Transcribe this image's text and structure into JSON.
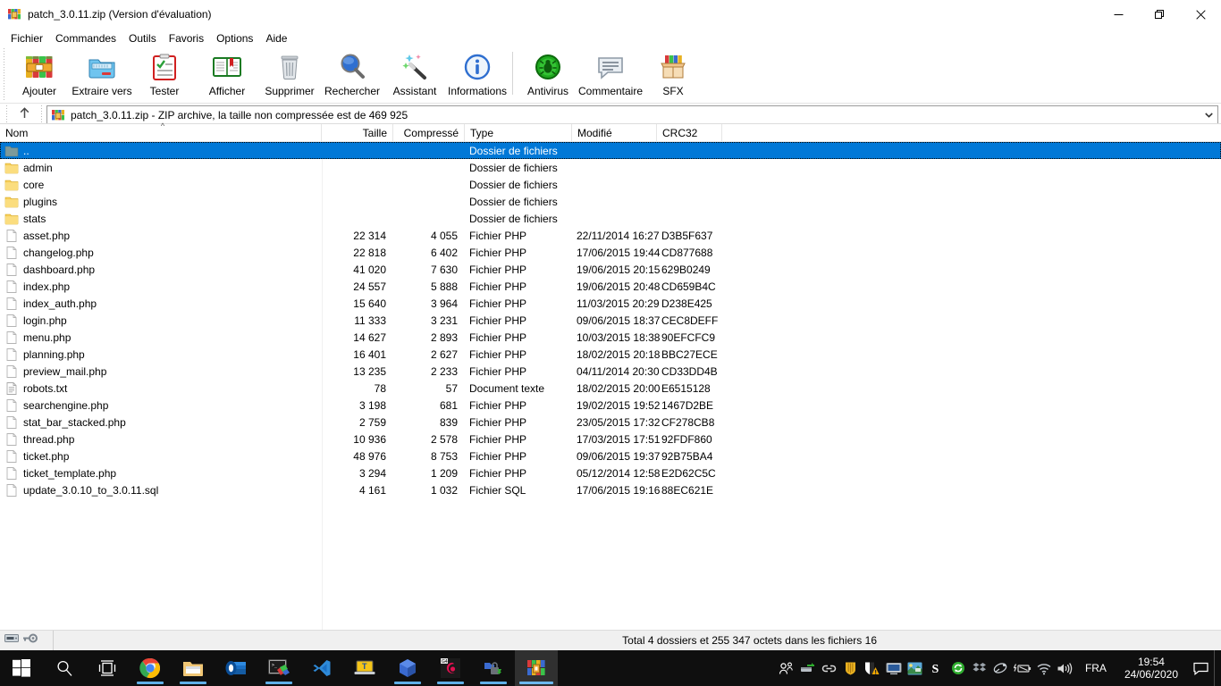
{
  "window": {
    "title": "patch_3.0.11.zip (Version d'évaluation)",
    "app_icon": "winrar-books-icon",
    "controls": {
      "minimize": "—",
      "restore": "❐",
      "close": "✕"
    }
  },
  "menubar": {
    "items": [
      {
        "label": "Fichier"
      },
      {
        "label": "Commandes"
      },
      {
        "label": "Outils"
      },
      {
        "label": "Favoris"
      },
      {
        "label": "Options"
      },
      {
        "label": "Aide"
      }
    ]
  },
  "toolbar": {
    "buttons": [
      {
        "label": "Ajouter",
        "icon": "add-archive-icon"
      },
      {
        "label": "Extraire vers",
        "icon": "extract-folder-icon"
      },
      {
        "label": "Tester",
        "icon": "test-clipboard-icon"
      },
      {
        "label": "Afficher",
        "icon": "view-book-icon"
      },
      {
        "label": "Supprimer",
        "icon": "delete-trash-icon"
      },
      {
        "label": "Rechercher",
        "icon": "search-magnifier-icon"
      },
      {
        "label": "Assistant",
        "icon": "wizard-wand-icon"
      },
      {
        "label": "Informations",
        "icon": "info-circle-icon"
      },
      {
        "label": "Antivirus",
        "icon": "antivirus-bug-icon"
      },
      {
        "label": "Commentaire",
        "icon": "comment-bubble-icon"
      },
      {
        "label": "SFX",
        "icon": "sfx-box-icon"
      }
    ],
    "separator_after_index": 7
  },
  "addressbar": {
    "up_button": "up-arrow-icon",
    "archive_icon": "winrar-books-icon",
    "path_text": "patch_3.0.11.zip - ZIP archive, la taille non compressée est de 469 925",
    "dropdown": "chevron-down-icon"
  },
  "filelist": {
    "columns": [
      {
        "label": "Nom",
        "align": "left"
      },
      {
        "label": "Taille",
        "align": "right"
      },
      {
        "label": "Compressé",
        "align": "right"
      },
      {
        "label": "Type",
        "align": "left"
      },
      {
        "label": "Modifié",
        "align": "left"
      },
      {
        "label": "CRC32",
        "align": "left"
      }
    ],
    "sort_indicator": "^",
    "rows": [
      {
        "name": "..",
        "size": "",
        "compressed": "",
        "type": "Dossier de fichiers",
        "modified": "",
        "crc32": "",
        "icon": "parent-folder-icon",
        "selected": true
      },
      {
        "name": "admin",
        "size": "",
        "compressed": "",
        "type": "Dossier de fichiers",
        "modified": "",
        "crc32": "",
        "icon": "folder-icon",
        "selected": false
      },
      {
        "name": "core",
        "size": "",
        "compressed": "",
        "type": "Dossier de fichiers",
        "modified": "",
        "crc32": "",
        "icon": "folder-icon",
        "selected": false
      },
      {
        "name": "plugins",
        "size": "",
        "compressed": "",
        "type": "Dossier de fichiers",
        "modified": "",
        "crc32": "",
        "icon": "folder-icon",
        "selected": false
      },
      {
        "name": "stats",
        "size": "",
        "compressed": "",
        "type": "Dossier de fichiers",
        "modified": "",
        "crc32": "",
        "icon": "folder-icon",
        "selected": false
      },
      {
        "name": "asset.php",
        "size": "22 314",
        "compressed": "4 055",
        "type": "Fichier PHP",
        "modified": "22/11/2014 16:27",
        "crc32": "D3B5F637",
        "icon": "file-icon",
        "selected": false
      },
      {
        "name": "changelog.php",
        "size": "22 818",
        "compressed": "6 402",
        "type": "Fichier PHP",
        "modified": "17/06/2015 19:44",
        "crc32": "CD877688",
        "icon": "file-icon",
        "selected": false
      },
      {
        "name": "dashboard.php",
        "size": "41 020",
        "compressed": "7 630",
        "type": "Fichier PHP",
        "modified": "19/06/2015 20:15",
        "crc32": "629B0249",
        "icon": "file-icon",
        "selected": false
      },
      {
        "name": "index.php",
        "size": "24 557",
        "compressed": "5 888",
        "type": "Fichier PHP",
        "modified": "19/06/2015 20:48",
        "crc32": "CD659B4C",
        "icon": "file-icon",
        "selected": false
      },
      {
        "name": "index_auth.php",
        "size": "15 640",
        "compressed": "3 964",
        "type": "Fichier PHP",
        "modified": "11/03/2015 20:29",
        "crc32": "D238E425",
        "icon": "file-icon",
        "selected": false
      },
      {
        "name": "login.php",
        "size": "11 333",
        "compressed": "3 231",
        "type": "Fichier PHP",
        "modified": "09/06/2015 18:37",
        "crc32": "CEC8DEFF",
        "icon": "file-icon",
        "selected": false
      },
      {
        "name": "menu.php",
        "size": "14 627",
        "compressed": "2 893",
        "type": "Fichier PHP",
        "modified": "10/03/2015 18:38",
        "crc32": "90EFCFC9",
        "icon": "file-icon",
        "selected": false
      },
      {
        "name": "planning.php",
        "size": "16 401",
        "compressed": "2 627",
        "type": "Fichier PHP",
        "modified": "18/02/2015 20:18",
        "crc32": "BBC27ECE",
        "icon": "file-icon",
        "selected": false
      },
      {
        "name": "preview_mail.php",
        "size": "13 235",
        "compressed": "2 233",
        "type": "Fichier PHP",
        "modified": "04/11/2014 20:30",
        "crc32": "CD33DD4B",
        "icon": "file-icon",
        "selected": false
      },
      {
        "name": "robots.txt",
        "size": "78",
        "compressed": "57",
        "type": "Document texte",
        "modified": "18/02/2015 20:00",
        "crc32": "E6515128",
        "icon": "text-file-icon",
        "selected": false
      },
      {
        "name": "searchengine.php",
        "size": "3 198",
        "compressed": "681",
        "type": "Fichier PHP",
        "modified": "19/02/2015 19:52",
        "crc32": "1467D2BE",
        "icon": "file-icon",
        "selected": false
      },
      {
        "name": "stat_bar_stacked.php",
        "size": "2 759",
        "compressed": "839",
        "type": "Fichier PHP",
        "modified": "23/05/2015 17:32",
        "crc32": "CF278CB8",
        "icon": "file-icon",
        "selected": false
      },
      {
        "name": "thread.php",
        "size": "10 936",
        "compressed": "2 578",
        "type": "Fichier PHP",
        "modified": "17/03/2015 17:51",
        "crc32": "92FDF860",
        "icon": "file-icon",
        "selected": false
      },
      {
        "name": "ticket.php",
        "size": "48 976",
        "compressed": "8 753",
        "type": "Fichier PHP",
        "modified": "09/06/2015 19:37",
        "crc32": "92B75BA4",
        "icon": "file-icon",
        "selected": false
      },
      {
        "name": "ticket_template.php",
        "size": "3 294",
        "compressed": "1 209",
        "type": "Fichier PHP",
        "modified": "05/12/2014 12:58",
        "crc32": "E2D62C5C",
        "icon": "file-icon",
        "selected": false
      },
      {
        "name": "update_3.0.10_to_3.0.11.sql",
        "size": "4 161",
        "compressed": "1 032",
        "type": "Fichier SQL",
        "modified": "17/06/2015 19:16",
        "crc32": "88EC621E",
        "icon": "file-icon",
        "selected": false
      }
    ]
  },
  "statusbar": {
    "disk_icon": "drive-icon",
    "key_icon": "key-icon",
    "text": "Total 4 dossiers et 255 347 octets dans les fichiers 16"
  },
  "taskbar": {
    "start": "windows-start-icon",
    "items": [
      {
        "name": "search-icon",
        "running": false,
        "active": false
      },
      {
        "name": "task-view-icon",
        "running": false,
        "active": false
      },
      {
        "name": "chrome-icon",
        "running": true,
        "active": false
      },
      {
        "name": "file-explorer-icon",
        "running": true,
        "active": false
      },
      {
        "name": "outlook-icon",
        "running": false,
        "active": false
      },
      {
        "name": "console-icon",
        "running": true,
        "active": false
      },
      {
        "name": "vscode-icon",
        "running": false,
        "active": false
      },
      {
        "name": "teamviewer-icon",
        "running": false,
        "active": false
      },
      {
        "name": "virtualbox-icon",
        "running": true,
        "active": false
      },
      {
        "name": "camtasia-icon",
        "running": true,
        "active": false
      },
      {
        "name": "unlocker-icon",
        "running": true,
        "active": false
      },
      {
        "name": "winrar-icon",
        "running": true,
        "active": true
      }
    ],
    "tray": [
      {
        "name": "people-icon"
      },
      {
        "name": "network-share-icon"
      },
      {
        "name": "link-icon"
      },
      {
        "name": "shield-gold-icon"
      },
      {
        "name": "security-warning-icon"
      },
      {
        "name": "display-icon"
      },
      {
        "name": "network-map-icon"
      },
      {
        "name": "sync-s-icon"
      },
      {
        "name": "refresh-green-icon"
      },
      {
        "name": "dropbox-icon"
      },
      {
        "name": "satellite-icon"
      },
      {
        "name": "battery-icon"
      },
      {
        "name": "wifi-icon"
      },
      {
        "name": "volume-icon"
      }
    ],
    "language": "FRA",
    "clock": {
      "time": "19:54",
      "date": "24/06/2020"
    },
    "action_center": "notification-icon"
  }
}
